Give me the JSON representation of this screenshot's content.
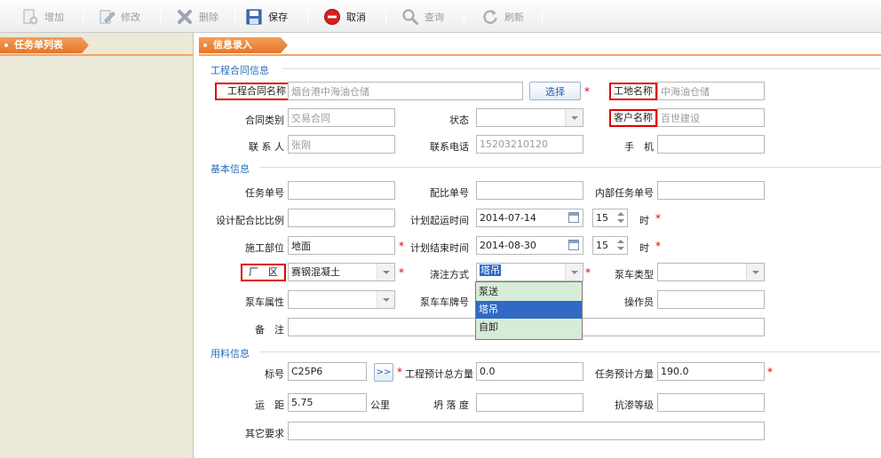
{
  "toolbar": {
    "add": "增加",
    "edit": "修改",
    "delete": "删除",
    "save": "保存",
    "cancel": "取消",
    "query": "查询",
    "refresh": "刷新"
  },
  "left_panel": {
    "title": "任务单列表"
  },
  "main_panel": {
    "title": "信息录入"
  },
  "sections": {
    "contract": "工程合同信息",
    "basic": "基本信息",
    "material": "用料信息"
  },
  "contract": {
    "contract_name_label": "工程合同名称",
    "contract_name_value": "烟台港中海油仓储",
    "select_button": "选择",
    "site_name_label": "工地名称",
    "site_name_value": "中海油仓储",
    "contract_type_label": "合同类别",
    "contract_type_value": "交易合同",
    "status_label": "状态",
    "status_value": "",
    "customer_name_label": "客户名称",
    "customer_name_value": "百世建设",
    "contact_label": "联 系 人",
    "contact_value": "张刚",
    "phone_label": "联系电话",
    "phone_value": "15203210120",
    "mobile_label": "手　机",
    "mobile_value": ""
  },
  "basic": {
    "task_no_label": "任务单号",
    "task_no_value": "",
    "mix_no_label": "配比单号",
    "mix_no_value": "",
    "internal_no_label": "内部任务单号",
    "internal_no_value": "",
    "design_ratio_label": "设计配合比比例",
    "design_ratio_value": "",
    "plan_start_label": "计划起运时间",
    "plan_start_date": "2014-07-14",
    "plan_start_hour": "15",
    "hour_unit": "时",
    "site_part_label": "施工部位",
    "site_part_value": "地面",
    "plan_end_label": "计划结束时间",
    "plan_end_date": "2014-08-30",
    "plan_end_hour": "15",
    "factory_label": "厂　区",
    "factory_value": "赛钢混凝土",
    "pour_method_label": "浇注方式",
    "pour_method_value": "塔吊",
    "pump_type_label": "泵车类型",
    "pump_type_value": "",
    "pump_attr_label": "泵车属性",
    "pump_attr_value": "",
    "pump_plate_label": "泵车车牌号",
    "operator_label": "操作员",
    "operator_value": "",
    "remark_label": "备　注",
    "remark_value": "",
    "pour_options": [
      "泵送",
      "塔吊",
      "自卸"
    ],
    "pour_selected_index": 1
  },
  "material": {
    "grade_label": "标号",
    "grade_value": "C25P6",
    "grade_button": ">>",
    "total_volume_label": "工程预计总方量",
    "total_volume_value": "0.0",
    "task_volume_label": "任务预计方量",
    "task_volume_value": "190.0",
    "distance_label": "运　距",
    "distance_value": "5.75",
    "distance_unit": "公里",
    "slump_label": "坍 落 度",
    "slump_value": "",
    "impermeability_label": "抗渗等级",
    "impermeability_value": "",
    "other_label": "其它要求",
    "other_value": ""
  },
  "required_mark": "*",
  "colors": {
    "accent": "#e2772c",
    "section": "#2a6fbd",
    "highlight_box": "#e00000",
    "selection": "#316ac5"
  }
}
